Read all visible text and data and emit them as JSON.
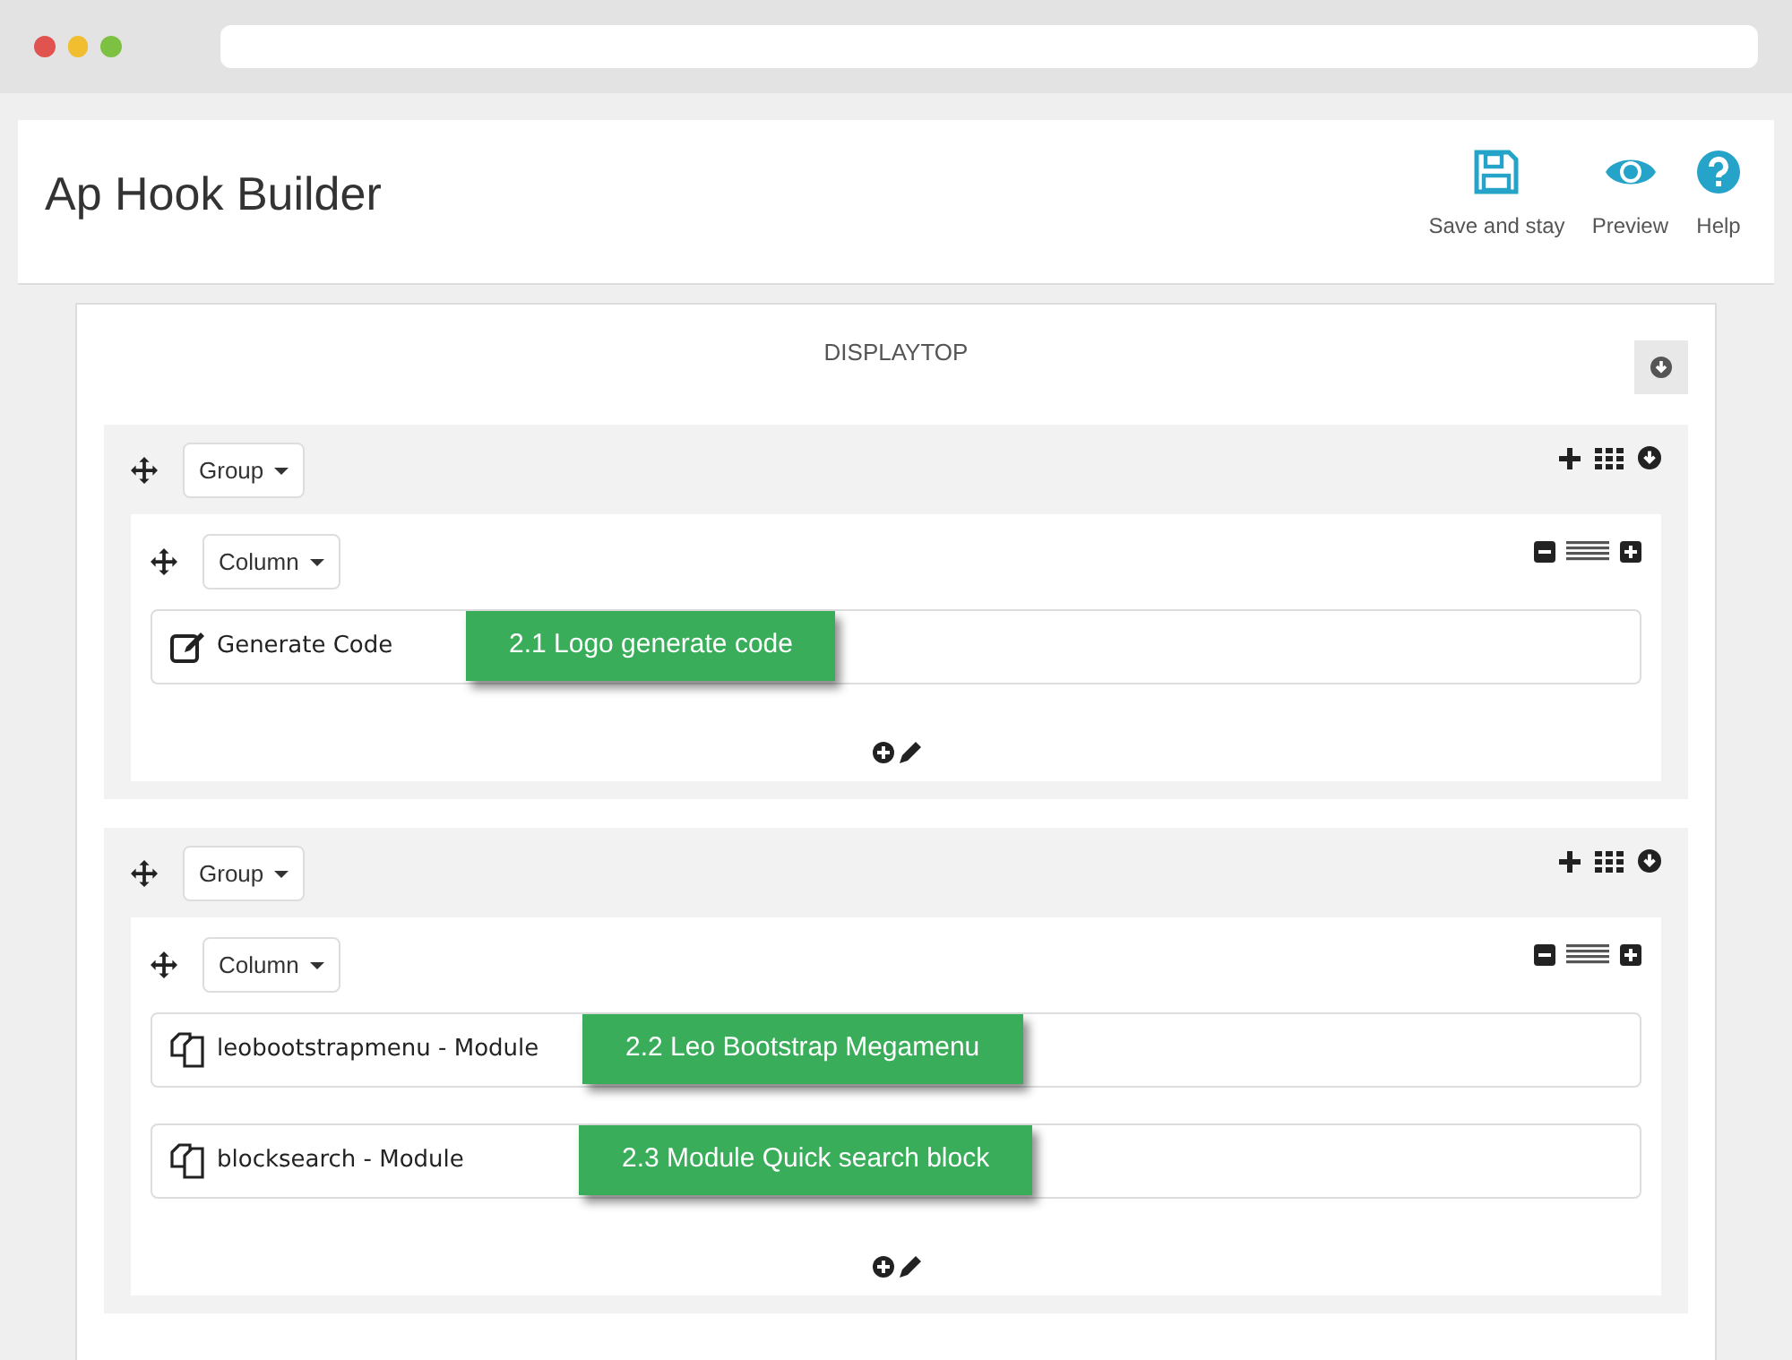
{
  "page": {
    "title": "Ap Hook Builder"
  },
  "toolbar": [
    {
      "kind": "save",
      "label": "Save and stay"
    },
    {
      "kind": "preview",
      "label": "Preview"
    },
    {
      "kind": "help",
      "label": "Help"
    }
  ],
  "hook": {
    "title": "DISPLAYTOP"
  },
  "groups": [
    {
      "label": "Group",
      "column": {
        "label": "Column",
        "items": [
          {
            "kind": "code",
            "label": "Generate Code",
            "callout": "2.1 Logo generate code"
          }
        ]
      }
    },
    {
      "label": "Group",
      "column": {
        "label": "Column",
        "items": [
          {
            "kind": "module",
            "label": "leobootstrapmenu - Module",
            "callout": "2.2 Leo Bootstrap Megamenu"
          },
          {
            "kind": "module",
            "label": "blocksearch - Module",
            "callout": "2.3 Module Quick search block"
          }
        ]
      }
    }
  ]
}
